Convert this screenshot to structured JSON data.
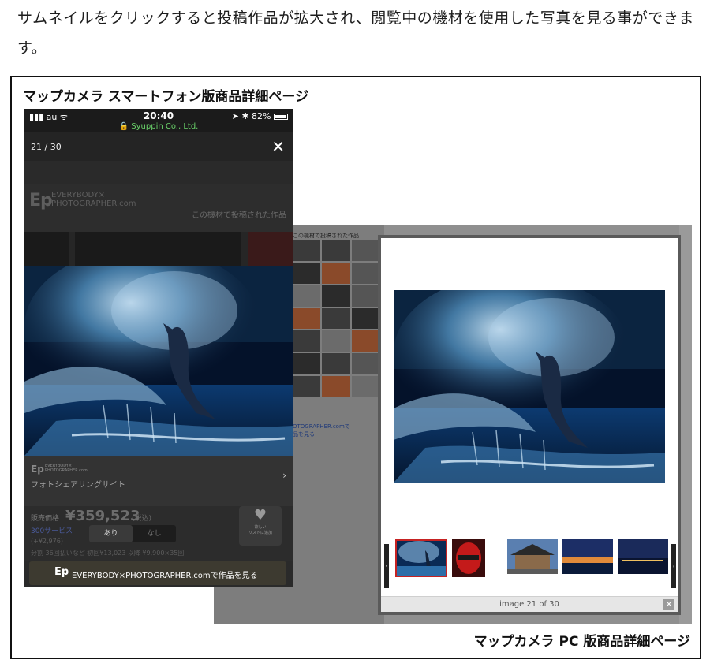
{
  "intro_text": "サムネイルをクリックすると投稿作品が拡大され、閲覧中の機材を使用した写真を見る事ができます。",
  "smartphone_section_title": "マップカメラ スマートフォン版商品詳細ページ",
  "pc_section_title": "マップカメラ PC 版商品詳細ページ",
  "smartphone": {
    "status_bar": {
      "carrier": "au",
      "time": "20:40",
      "domain": "Syuppin Co., Ltd.",
      "battery": "82%"
    },
    "lightbox": {
      "counter": "21 / 30"
    },
    "page_behind": {
      "ep_logo_line1": "EVERYBODY×",
      "ep_logo_line2": "PHOTOGRAPHER.com",
      "posted_caption": "この機材で投稿された作品",
      "share_logo_line1": "EVERYBODY×",
      "share_logo_line2": "PHOTOGRAPHER.com",
      "share_site": "フォトシェアリングサイト",
      "price_label": "販売価格",
      "price": "¥359,523",
      "price_tax": "(税込)",
      "service_link": "300サービス",
      "points": "(+¥2,976)",
      "loan_text": "分割 36回払いなど 初回¥13,023 以降 ¥9,900×35回",
      "toggle_on": "あり",
      "toggle_off": "なし",
      "wish_text_line1": "欲しい",
      "wish_text_line2": "リストに追加"
    },
    "cta_logo": "Ep",
    "cta_text": "EVERYBODY×PHOTOGRAPHER.comで作品を見る"
  },
  "pc": {
    "page_caption": "この機材で投稿された作品",
    "page_link_line1": "OTOGRAPHER.comで",
    "page_link_line2": "品を見る",
    "lightbox": {
      "status_text": "image 21 of 30",
      "close_glyph": "✕"
    }
  }
}
